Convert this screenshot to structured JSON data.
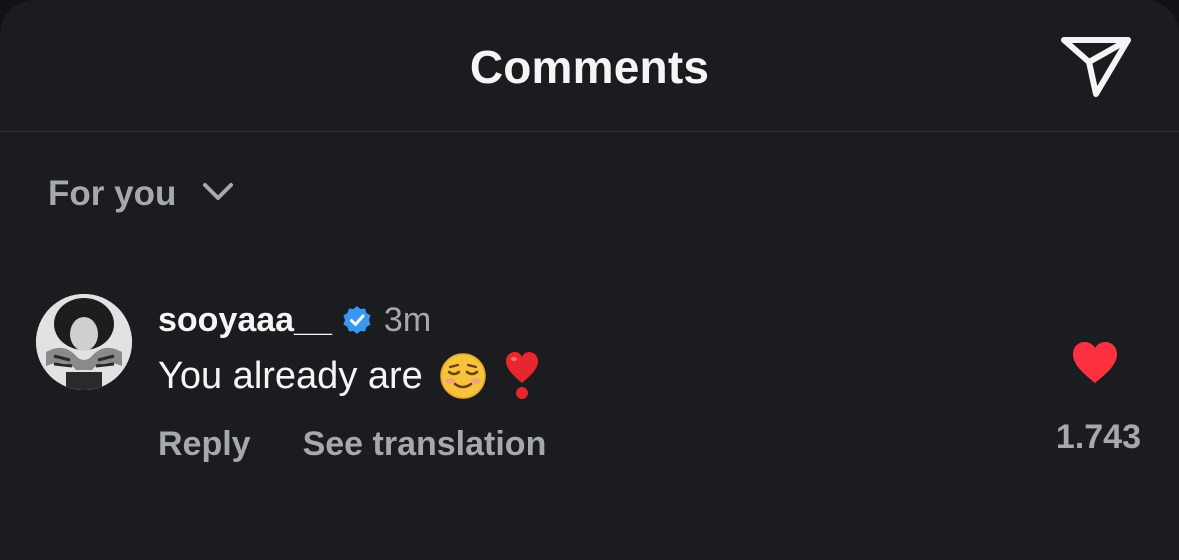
{
  "header": {
    "title": "Comments",
    "share_icon": "paper-plane-icon"
  },
  "filter": {
    "label": "For you",
    "icon": "chevron-down-icon"
  },
  "comments": [
    {
      "username": "sooyaaa__",
      "verified": true,
      "time": "3m",
      "text": "You already are",
      "emojis": [
        "smiling-face-emoji",
        "heart-exclamation-emoji"
      ],
      "reply_label": "Reply",
      "translate_label": "See translation",
      "liked": true,
      "like_count": "1.743"
    }
  ],
  "colors": {
    "background": "#1b1c1f",
    "text_primary": "#f5f5f5",
    "text_secondary": "#a5a8ae",
    "divider": "#33353a",
    "verified_blue": "#3897f0",
    "like_red": "#ff3040"
  }
}
